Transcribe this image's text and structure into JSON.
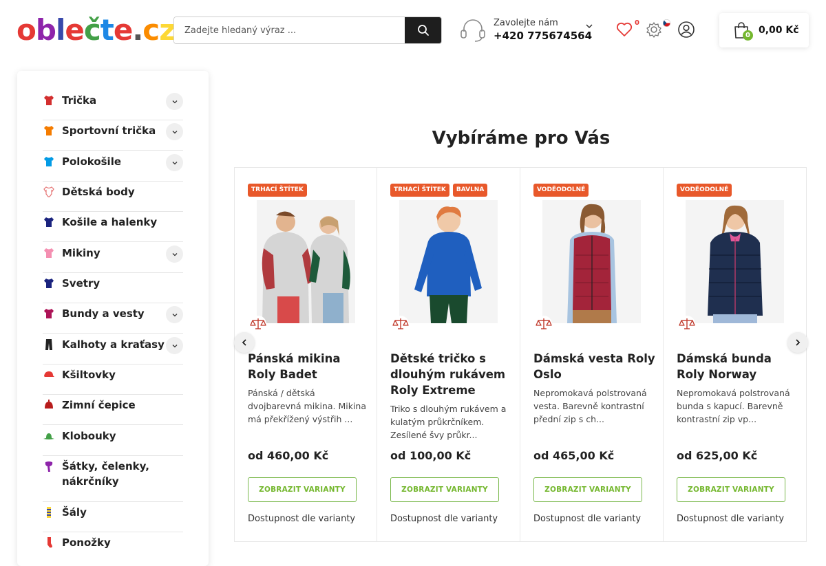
{
  "header": {
    "logo": {
      "letters": [
        "o",
        "b",
        "l",
        "e",
        "č",
        "t",
        "e",
        ".",
        "c",
        "z"
      ],
      "colors": [
        "#e53935",
        "#8e24aa",
        "#3949ab",
        "#e53935",
        "#43a047",
        "#1e88e5",
        "#e53935",
        "#555555",
        "#fb8c00",
        "#fdd835"
      ]
    },
    "search": {
      "placeholder": "Zadejte hledaný výraz ..."
    },
    "contact": {
      "label": "Zavolejte nám",
      "phone": "+420 775674564"
    },
    "wishlist_count": "0",
    "cart": {
      "count": "0",
      "total": "0,00 Kč"
    }
  },
  "sidebar": {
    "items": [
      {
        "label": "Trička",
        "icon": "tshirt-icon",
        "color": "#d32f2f",
        "expand": true
      },
      {
        "label": "Sportovní trička",
        "icon": "sport-tshirt-icon",
        "color": "#f57c00",
        "expand": true
      },
      {
        "label": "Polokošile",
        "icon": "polo-icon",
        "color": "#039be5",
        "expand": true
      },
      {
        "label": "Dětská body",
        "icon": "baby-body-icon",
        "color": "#e57373",
        "expand": false
      },
      {
        "label": "Košile a halenky",
        "icon": "shirt-icon",
        "color": "#1a237e",
        "expand": false
      },
      {
        "label": "Mikiny",
        "icon": "hoodie-icon",
        "color": "#f48fb1",
        "expand": true
      },
      {
        "label": "Svetry",
        "icon": "sweater-icon",
        "color": "#1a237e",
        "expand": false
      },
      {
        "label": "Bundy a vesty",
        "icon": "jacket-icon",
        "color": "#ad1457",
        "expand": true
      },
      {
        "label": "Kalhoty a kraťasy",
        "icon": "pants-icon",
        "color": "#222222",
        "expand": true
      },
      {
        "label": "Kšiltovky",
        "icon": "cap-icon",
        "color": "#e53935",
        "expand": false
      },
      {
        "label": "Zimní čepice",
        "icon": "winter-hat-icon",
        "color": "#b71c1c",
        "expand": false
      },
      {
        "label": "Klobouky",
        "icon": "hat-icon",
        "color": "#43a047",
        "expand": false
      },
      {
        "label": "Šátky, čelenky, nákrčníky",
        "icon": "scarf-icon",
        "color": "#8e24aa",
        "expand": false
      },
      {
        "label": "Šály",
        "icon": "shawl-icon",
        "color": "#fdd835",
        "expand": false
      },
      {
        "label": "Ponožky",
        "icon": "socks-icon",
        "color": "#e53935",
        "expand": false
      }
    ]
  },
  "section": {
    "title": "Vybíráme pro Vás"
  },
  "products": [
    {
      "tags": [
        "TRHACÍ ŠTÍTEK"
      ],
      "title": "Pánská mikina Roly Badet",
      "desc": "Pánská / dětská dvojbarevná mikina. Mikina má překřížený výstřih ...",
      "price": "od 460,00 Kč",
      "button": "ZOBRAZIT VARIANTY",
      "availability": "Dostupnost dle varianty",
      "image": "two-people-hoodies-photo",
      "colors": [
        "#b03a3e",
        "#d5d5d5",
        "#1d5a3a"
      ]
    },
    {
      "tags": [
        "TRHACÍ ŠTÍTEK",
        "BAVLNA"
      ],
      "title": "Dětské tričko s dlouhým rukávem Roly Extreme",
      "desc": "Triko s dlouhým rukávem a kulatým průkrčníkem. Zesílené švy průkr...",
      "price": "od 100,00 Kč",
      "button": "ZOBRAZIT VARIANTY",
      "availability": "Dostupnost dle varianty",
      "image": "boy-blue-longsleeve-photo",
      "colors": [
        "#1f5fbf",
        "#1a4a2e",
        "#e07a40"
      ]
    },
    {
      "tags": [
        "VODĚODOLNÉ"
      ],
      "title": "Dámská vesta Roly Oslo",
      "desc": "Nepromokavá polstrovaná vesta. Barevně kontrastní přední zip s ch...",
      "price": "od 465,00 Kč",
      "button": "ZOBRAZIT VARIANTY",
      "availability": "Dostupnost dle varianty",
      "image": "woman-red-vest-photo",
      "colors": [
        "#a3243a",
        "#a8c4e0",
        "#b07a4a"
      ]
    },
    {
      "tags": [
        "VODĚODOLNÉ"
      ],
      "title": "Dámská bunda Roly Norway",
      "desc": "Nepromokavá polstrovaná bunda s kapucí. Barevně kontrastní zip vp...",
      "price": "od 625,00 Kč",
      "button": "ZOBRAZIT VARIANTY",
      "availability": "Dostupnost dle varianty",
      "image": "woman-navy-jacket-photo",
      "colors": [
        "#1f2f4f",
        "#9fb8d8",
        "#c89a6a"
      ]
    }
  ]
}
